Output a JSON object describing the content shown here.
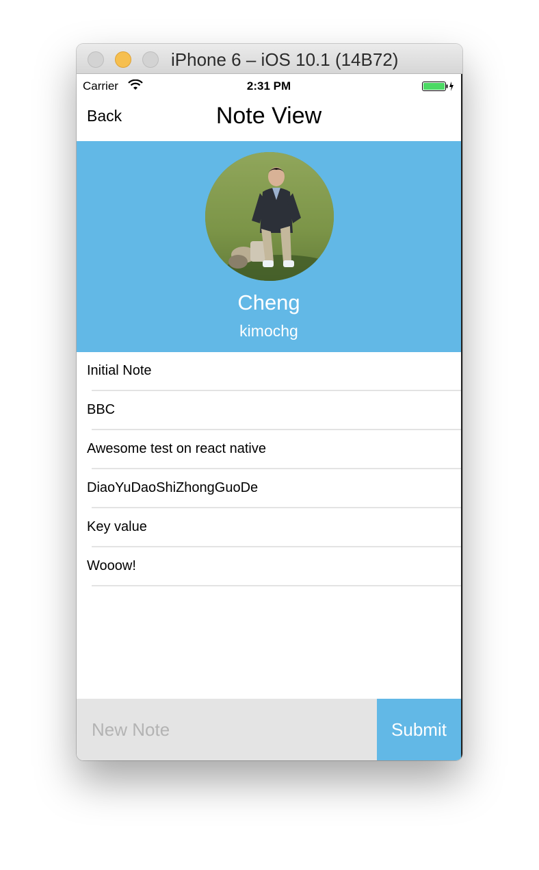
{
  "window": {
    "title": "iPhone 6 – iOS 10.1 (14B72)"
  },
  "status_bar": {
    "carrier": "Carrier",
    "time": "2:31 PM",
    "battery_color": "#4cd964"
  },
  "nav": {
    "back_label": "Back",
    "title": "Note View"
  },
  "profile": {
    "name": "Cheng",
    "username": "kimochg",
    "header_color": "#62b8e6"
  },
  "notes": [
    "Initial Note",
    "BBC",
    "Awesome test on react native",
    "DiaoYuDaoShiZhongGuoDe",
    "Key value",
    "Wooow!"
  ],
  "footer": {
    "input_placeholder": "New Note",
    "input_value": "",
    "submit_label": "Submit"
  }
}
